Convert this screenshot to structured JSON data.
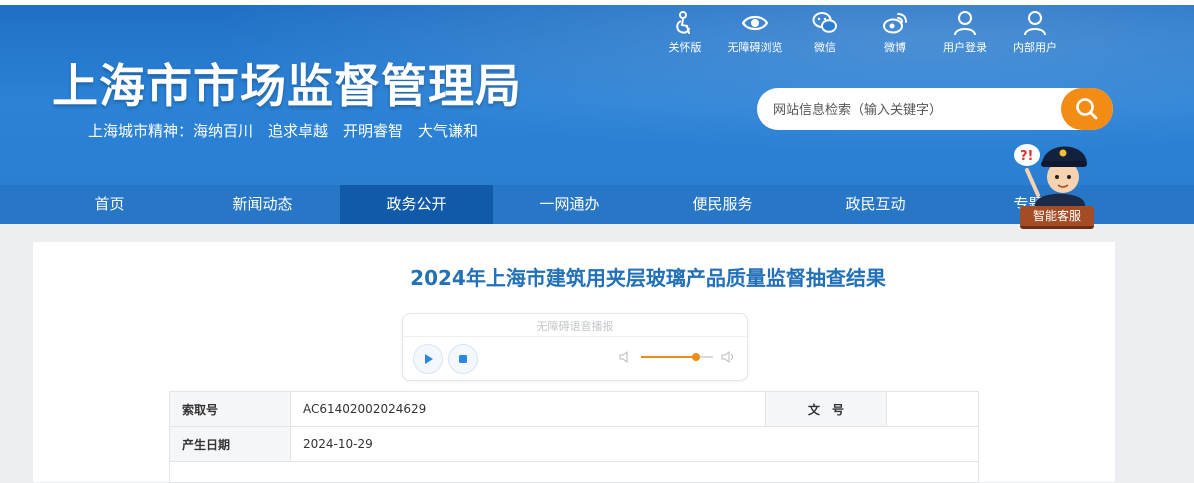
{
  "header": {
    "site_title": "上海市市场监督管理局",
    "slogan": "上海城市精神：海纳百川　追求卓越　开明睿智　大气谦和"
  },
  "toolbar": {
    "items": [
      {
        "label": "关怀版",
        "icon": "care-mode-icon"
      },
      {
        "label": "无障碍浏览",
        "icon": "eye-icon"
      },
      {
        "label": "微信",
        "icon": "wechat-icon"
      },
      {
        "label": "微博",
        "icon": "weibo-icon"
      },
      {
        "label": "用户登录",
        "icon": "user-icon"
      },
      {
        "label": "内部用户",
        "icon": "user-icon"
      }
    ]
  },
  "search": {
    "placeholder": "网站信息检索（输入关键字）"
  },
  "nav": {
    "items": [
      "首页",
      "新闻动态",
      "政务公开",
      "一网通办",
      "便民服务",
      "政民互动",
      "专题"
    ],
    "active": "政务公开"
  },
  "assistant": {
    "label": "智能客服"
  },
  "article": {
    "title": "2024年上海市建筑用夹层玻璃产品质量监督抽查结果"
  },
  "player": {
    "caption": "无障碍语音播报",
    "volume": 0.77
  },
  "meta": {
    "index_label": "索取号",
    "index_value": "AC61402002024629",
    "docno_label": "文　号",
    "docno_value": "",
    "date_label": "产生日期",
    "date_value": "2024-10-29"
  },
  "colors": {
    "header_blue": "#2a7fd2",
    "nav_blue": "#2876c6",
    "nav_active": "#115aa9",
    "title_blue": "#2170b8",
    "accent_orange": "#f28c14"
  }
}
